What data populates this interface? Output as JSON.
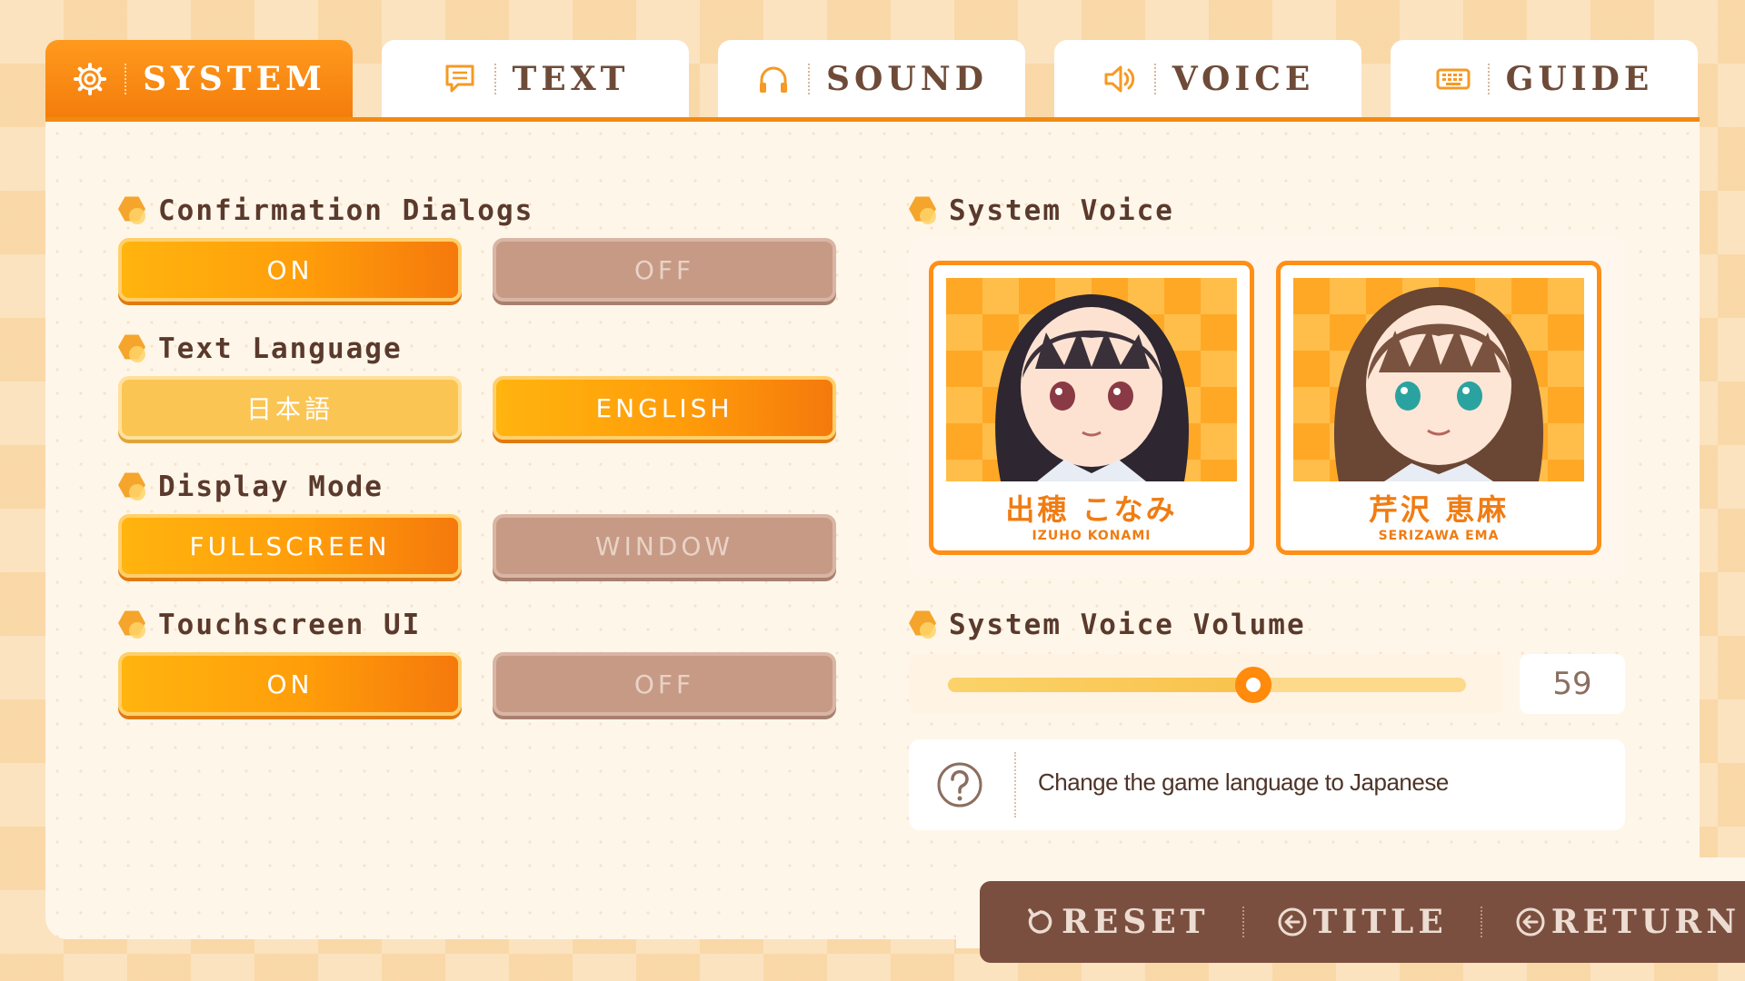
{
  "tabs": [
    {
      "label": "SYSTEM",
      "icon": "gear-icon",
      "active": true
    },
    {
      "label": "TEXT",
      "icon": "speech-bubble-icon",
      "active": false
    },
    {
      "label": "SOUND",
      "icon": "headphones-icon",
      "active": false
    },
    {
      "label": "VOICE",
      "icon": "speaker-icon",
      "active": false
    },
    {
      "label": "GUIDE",
      "icon": "keyboard-icon",
      "active": false
    }
  ],
  "settings": {
    "confirmation": {
      "title": "Confirmation Dialogs",
      "on": "ON",
      "off": "OFF",
      "selected": "ON"
    },
    "language": {
      "title": "Text Language",
      "ja": "日本語",
      "en": "ENGLISH",
      "selected": "ENGLISH"
    },
    "display": {
      "title": "Display Mode",
      "fullscreen": "FULLSCREEN",
      "window": "WINDOW",
      "selected": "FULLSCREEN"
    },
    "touch": {
      "title": "Touchscreen UI",
      "on": "ON",
      "off": "OFF",
      "selected": "ON"
    }
  },
  "system_voice": {
    "title": "System Voice",
    "characters": [
      {
        "name": "出穂 こなみ",
        "romaji": "IZUHO KONAMI"
      },
      {
        "name": "芹沢 恵麻",
        "romaji": "SERIZAWA EMA"
      }
    ]
  },
  "volume": {
    "title": "System Voice Volume",
    "value": "59",
    "level": 0.59
  },
  "help": {
    "text": "Change the game language to Japanese",
    "icon": "question-icon"
  },
  "bottom": {
    "reset": "RESET",
    "title": "TITLE",
    "return": "RETURN"
  },
  "colors": {
    "accent": "#f28a12",
    "off": "#c79a86",
    "bottom_bar": "#7b4f3f"
  }
}
